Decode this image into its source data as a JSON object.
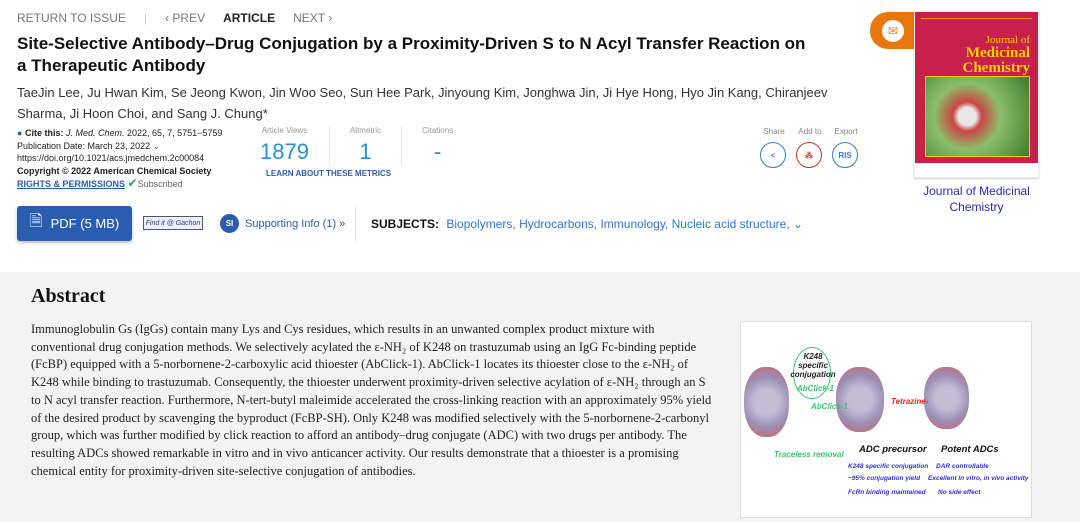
{
  "nav": {
    "return": "RETURN TO ISSUE",
    "prev": "PREV",
    "current": "ARTICLE",
    "next": "NEXT"
  },
  "title": "Site-Selective Antibody–Drug Conjugation by a Proximity-Driven S to N Acyl Transfer Reaction on a Therapeutic Antibody",
  "authors": "TaeJin Lee, Ju Hwan Kim, Se Jeong Kwon, Jin Woo Seo, Sun Hee Park, Jinyoung Kim, Jonghwa Jin, Ji Hye Hong, Hyo Jin Kang, Chiranjeev Sharma, Ji Hoon Choi, and Sang J. Chung*",
  "cite": {
    "label": "Cite this:",
    "journal": "J. Med. Chem.",
    "ref": "2022, 65, 7, 5751−5759",
    "pubdate": "Publication Date: March 23, 2022",
    "doi": "https://doi.org/10.1021/acs.jmedchem.2c00084",
    "copyright": "Copyright © 2022 American Chemical Society",
    "rights": "RIGHTS & PERMISSIONS",
    "subscribed": "Subscribed"
  },
  "metrics": [
    {
      "label": "Article Views",
      "value": "1879"
    },
    {
      "label": "Altmetric",
      "value": "1"
    },
    {
      "label": "Citations",
      "value": "-"
    }
  ],
  "learn": "LEARN ABOUT THESE METRICS",
  "tools": [
    {
      "label": "Share",
      "icon": "share-icon"
    },
    {
      "label": "Add to",
      "icon": "add-to-icon"
    },
    {
      "label": "Export",
      "text": "RIS"
    }
  ],
  "pdf": "PDF (5 MB)",
  "findit": "Find it @ Gachon",
  "si": {
    "badge": "SI",
    "label": "Supporting Info (1) »"
  },
  "subjects": {
    "label": "SUBJECTS:",
    "items": [
      "Biopolymers,",
      "Hydrocarbons,",
      "Immunology,",
      "Nucleic acid structure,"
    ]
  },
  "cover": {
    "line1": "Journal of",
    "line2": "Medicinal",
    "line3": "Chemistry",
    "caption": "Journal of Medicinal Chemistry"
  },
  "abstract": {
    "heading": "Abstract",
    "text": "Immunoglobulin Gs (IgGs) contain many Lys and Cys residues, which results in an unwanted complex product mixture with conventional drug conjugation methods. We selectively acylated the ε-NH₂ of K248 on trastuzumab using an IgG Fc-binding peptide (FcBP) equipped with a 5-norbornene-2-carboxylic acid thioester (AbClick-1). AbClick-1 locates its thioester close to the ε-NH₂ of K248 while binding to trastuzumab. Consequently, the thioester underwent proximity-driven selective acylation of ε-NH₂ through an S to N acyl transfer reaction. Furthermore, N-tert-butyl maleimide accelerated the cross-linking reaction with an approximately 95% yield of the desired product by scavenging the byproduct (FcBP-SH). Only K248 was modified selectively with the 5-norbornene-2-carbonyl group, which was further modified by click reaction to afford an antibody–drug conjugate (ADC) with two drugs per antibody. The resulting ADCs showed remarkable in vitro and in vivo anticancer activity. Our results demonstrate that a thioester is a promising chemical entity for proximity-driven site-selective conjugation of antibodies."
  },
  "toc": {
    "k248": "K248 specific conjugation",
    "abclick_in": "AbClick-1",
    "abclick": "AbClick-1",
    "traceless": "Traceless removal",
    "tetrazine": "Tetrazine-",
    "precursor": "ADC precursor",
    "potent": "Potent ADCs",
    "b1": "K248 specific conjugation",
    "b2": "~95% conjugation yield",
    "b3": "FcRn binding maintained",
    "b4": "DAR controllable",
    "b5": "Excellent in vitro, in vivo activity",
    "b6": "No side effect"
  },
  "colors": {
    "accent": "#2a5db0",
    "metric": "#2a8fd6",
    "mail": "#e8770e",
    "cover": "#c8204a"
  }
}
